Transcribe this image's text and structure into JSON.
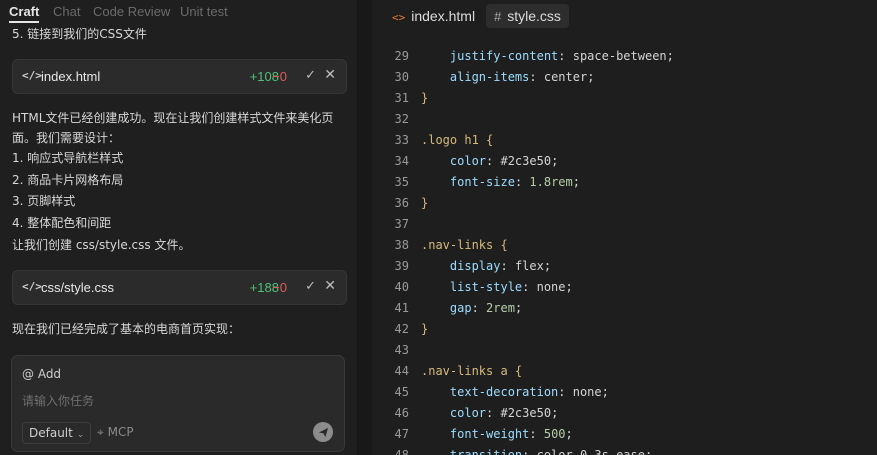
{
  "chat": {
    "tabs": [
      "Craft",
      "Chat",
      "Code Review",
      "Unit test"
    ],
    "partial_line": "5. 链接到我们的CSS文件",
    "file1": {
      "name": "index.html",
      "added": "+108",
      "removed": "−0"
    },
    "para": "HTML文件已经创建成功。现在让我们创建样式文件来美化页面。我们需要设计：",
    "list": [
      "1. 响应式导航栏样式",
      "2. 商品卡片网格布局",
      "3. 页脚样式",
      "4. 整体配色和间距"
    ],
    "create_line": "让我们创建 css/style.css 文件。",
    "file2": {
      "name": "css/style.css",
      "added": "+188",
      "removed": "−0"
    },
    "done_line": "现在我们已经完成了基本的电商首页实现：",
    "input": {
      "add_label": "@ Add",
      "placeholder": "请输入你任务",
      "model": "Default",
      "mcp_label": "MCP"
    }
  },
  "editor": {
    "tabs": [
      {
        "label": "index.html",
        "icon": "html-code-icon"
      },
      {
        "label": "style.css",
        "icon": "css-hash-icon"
      }
    ],
    "active_tab": "style.css",
    "lines": [
      {
        "n": "29",
        "kind": "decl",
        "prop": "justify-content",
        "val": "space-between",
        "num": false
      },
      {
        "n": "30",
        "kind": "decl",
        "prop": "align-items",
        "val": "center",
        "num": false
      },
      {
        "n": "31",
        "kind": "close"
      },
      {
        "n": "32",
        "kind": "blank"
      },
      {
        "n": "33",
        "kind": "open",
        "sel": ".logo h1"
      },
      {
        "n": "34",
        "kind": "decl",
        "prop": "color",
        "val": "#2c3e50",
        "num": false
      },
      {
        "n": "35",
        "kind": "decl",
        "prop": "font-size",
        "val": "1.8rem",
        "num": true
      },
      {
        "n": "36",
        "kind": "close"
      },
      {
        "n": "37",
        "kind": "blank"
      },
      {
        "n": "38",
        "kind": "open",
        "sel": ".nav-links"
      },
      {
        "n": "39",
        "kind": "decl",
        "prop": "display",
        "val": "flex",
        "num": false
      },
      {
        "n": "40",
        "kind": "decl",
        "prop": "list-style",
        "val": "none",
        "num": false
      },
      {
        "n": "41",
        "kind": "decl",
        "prop": "gap",
        "val": "2rem",
        "num": true
      },
      {
        "n": "42",
        "kind": "close"
      },
      {
        "n": "43",
        "kind": "blank"
      },
      {
        "n": "44",
        "kind": "open",
        "sel": ".nav-links a"
      },
      {
        "n": "45",
        "kind": "decl",
        "prop": "text-decoration",
        "val": "none",
        "num": false
      },
      {
        "n": "46",
        "kind": "decl",
        "prop": "color",
        "val": "#2c3e50",
        "num": false
      },
      {
        "n": "47",
        "kind": "decl",
        "prop": "font-weight",
        "val": "500",
        "num": true
      },
      {
        "n": "48",
        "kind": "decl",
        "prop": "transition",
        "val": "color 0.3s ease",
        "num": false
      }
    ]
  }
}
